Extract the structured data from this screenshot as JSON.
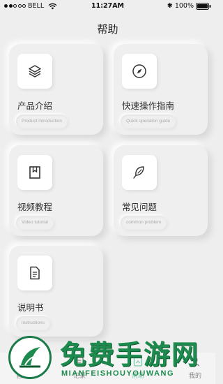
{
  "status_bar": {
    "carrier": "BELL",
    "time": "11:27AM",
    "battery": "100%"
  },
  "header": {
    "title": "帮助"
  },
  "cards": [
    {
      "icon": "layers-icon",
      "title": "产品介绍",
      "subtitle": "Product introduction"
    },
    {
      "icon": "compass-icon",
      "title": "快速操作指南",
      "subtitle": "Quick operation guide"
    },
    {
      "icon": "bookmark-icon",
      "title": "视频教程",
      "subtitle": "Video tutorial"
    },
    {
      "icon": "leaf-icon",
      "title": "常见问题",
      "subtitle": "common problem"
    },
    {
      "icon": "document-icon",
      "title": "说明书",
      "subtitle": "instructions"
    }
  ],
  "tabbar": {
    "items": [
      {
        "label": "首页",
        "icon": "home-icon"
      },
      {
        "label": "记录",
        "icon": "record-icon"
      },
      {
        "label": "帮助",
        "icon": "help-icon",
        "active": true
      },
      {
        "label": "我的",
        "icon": "user-icon"
      }
    ]
  },
  "watermark": {
    "text": "免费手游网",
    "subtext": "MIANFEISHOUYOUWANG"
  },
  "colors": {
    "background": "#eeeeee",
    "card": "#efefef",
    "active_tab": "#78c9a9",
    "watermark_green": "#1d8a4e"
  }
}
